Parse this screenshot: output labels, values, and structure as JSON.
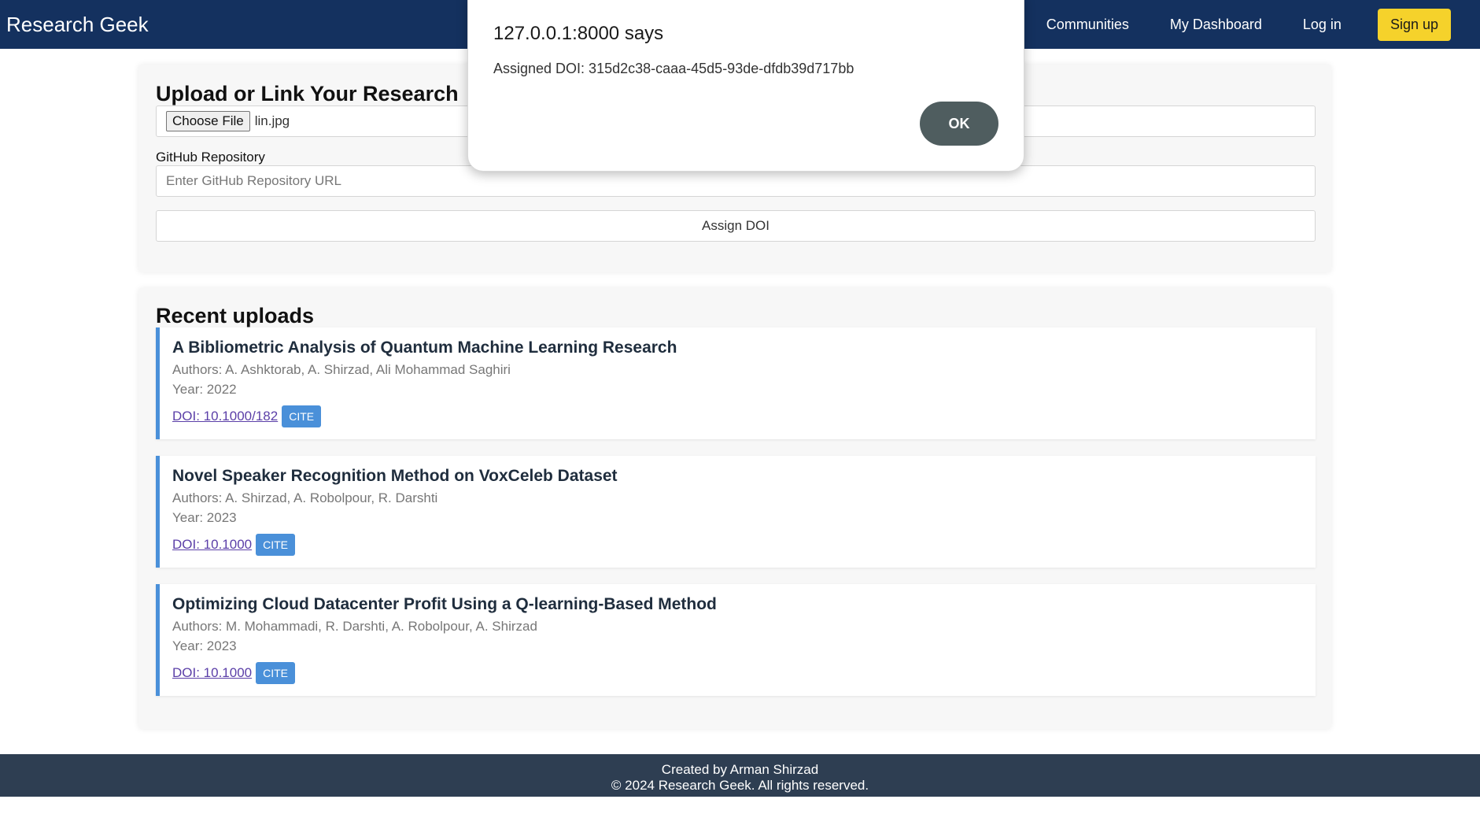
{
  "header": {
    "brand": "Research Geek",
    "nav": [
      "Communities",
      "My Dashboard",
      "Log in"
    ],
    "signup_label": "Sign up"
  },
  "upload": {
    "title": "Upload or Link Your Research",
    "choose_file_label": "Choose File",
    "file_name": "lin.jpg",
    "github_label": "GitHub Repository",
    "github_placeholder": "Enter GitHub Repository URL",
    "assign_label": "Assign DOI"
  },
  "recent": {
    "title": "Recent uploads",
    "items": [
      {
        "title": "A Bibliometric Analysis of Quantum Machine Learning Research",
        "authors": "Authors: A. Ashktorab, A. Shirzad, Ali Mohammad Saghiri",
        "year": "Year: 2022",
        "doi": "DOI: 10.1000/182",
        "cite": "CITE"
      },
      {
        "title": "Novel Speaker Recognition Method on VoxCeleb Dataset",
        "authors": "Authors: A. Shirzad, A. Robolpour, R. Darshti",
        "year": "Year: 2023",
        "doi": "DOI: 10.1000",
        "cite": "CITE"
      },
      {
        "title": "Optimizing Cloud Datacenter Profit Using a Q-learning-Based Method",
        "authors": "Authors: M. Mohammadi, R. Darshti, A. Robolpour, A. Shirzad",
        "year": "Year: 2023",
        "doi": "DOI: 10.1000",
        "cite": "CITE"
      }
    ]
  },
  "footer": {
    "line1": "Created by Arman Shirzad",
    "line2": "© 2024 Research Geek. All rights reserved."
  },
  "dialog": {
    "title": "127.0.0.1:8000 says",
    "message": "Assigned DOI: 315d2c38-caaa-45d5-93de-dfdb39d717bb",
    "ok_label": "OK"
  },
  "colors": {
    "navbar": "#14315f",
    "signup": "#f5d22b",
    "accent": "#4a90d9",
    "footer": "#2e3e52",
    "ok_button": "#4f5d5f"
  }
}
